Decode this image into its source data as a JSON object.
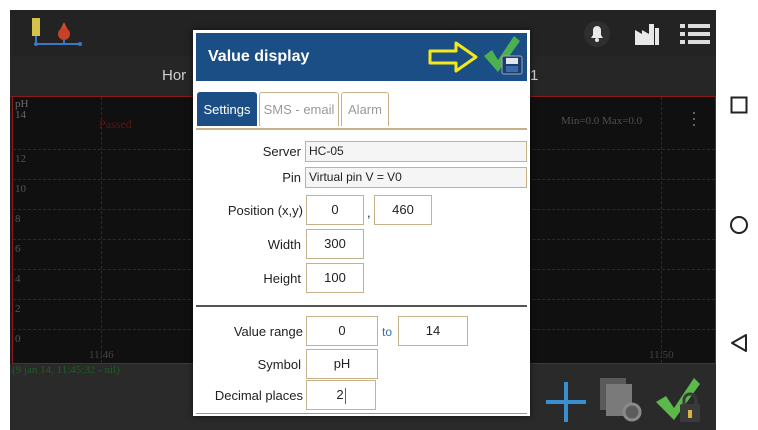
{
  "app": {
    "subbar": {
      "tab_left": "Hor",
      "tab_right": "1"
    },
    "chart": {
      "unit_top": "pH",
      "unit_bottom": "14",
      "status": "Passed",
      "minmax": "Min=0.0  Max=0.0",
      "y_ticks": [
        "12",
        "10",
        "8",
        "6",
        "4",
        "2",
        "0"
      ],
      "x_ticks": [
        "11:46",
        "11:50"
      ],
      "status_line": "(9 jan 14, 11:45:32 - nil)"
    },
    "icons": {
      "top_left": "level-sensor-icon",
      "top_right": [
        "bell-icon",
        "factory-icon",
        "list-menu-icon"
      ],
      "bottom": [
        "plus-icon",
        "settings-pages-icon",
        "check-lock-icon"
      ]
    }
  },
  "dialog": {
    "title": "Value display",
    "tabs": [
      {
        "label": "Settings",
        "active": true
      },
      {
        "label": "SMS - email",
        "active": false
      },
      {
        "label": "Alarm",
        "active": false
      }
    ],
    "server": {
      "label": "Server",
      "value": "HC-05"
    },
    "pin": {
      "label": "Pin",
      "value": "Virtual pin V = V0"
    },
    "position": {
      "label": "Position (x,y)",
      "x": "0",
      "separator": ",",
      "y": "460"
    },
    "width": {
      "label": "Width",
      "value": "300"
    },
    "height": {
      "label": "Height",
      "value": "100"
    },
    "value_range": {
      "label": "Value range",
      "from": "0",
      "to_label": "to",
      "to": "14"
    },
    "symbol": {
      "label": "Symbol",
      "value": "pH"
    },
    "decimal_places": {
      "label": "Decimal places",
      "value": "2"
    }
  },
  "colors": {
    "dialog_header": "#1c4e86",
    "accent_yellow": "#f4e81c",
    "save_green": "#4caf50",
    "chart_border": "#8a1a1a"
  }
}
